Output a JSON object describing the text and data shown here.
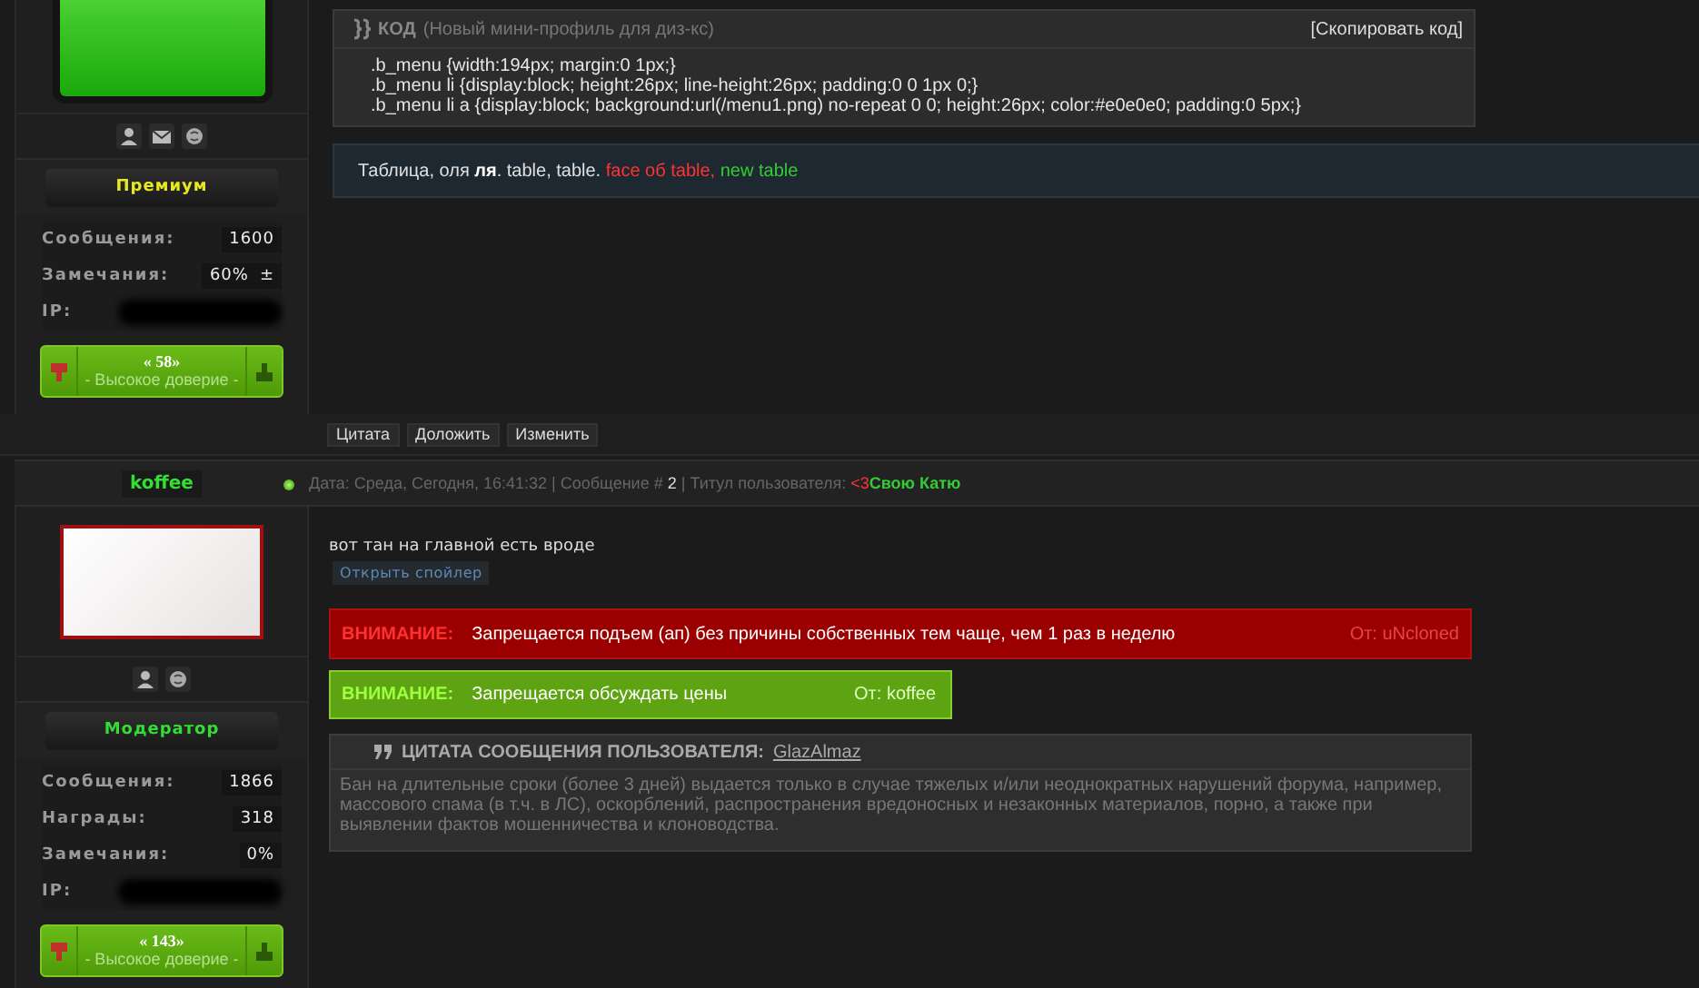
{
  "posts": [
    {
      "user": {
        "avatar": {
          "kind": "green-tile"
        },
        "contact_icons": [
          {
            "kind": "profile"
          },
          {
            "kind": "mail"
          },
          {
            "kind": "chat"
          }
        ],
        "rank": {
          "label": "Премиум",
          "color": "#e8e820"
        },
        "stats": [
          {
            "kind": "stat",
            "label": "Сообщения:",
            "value": "1600"
          },
          {
            "kind": "stat",
            "label": "Замечания:",
            "value": "60%",
            "extra": "±"
          },
          {
            "kind": "ip",
            "label": "IP:"
          }
        ],
        "reputation": {
          "score": "« 58»",
          "label": "- Высокое доверие -"
        }
      },
      "body": {
        "code": {
          "title": "КОД",
          "note": "(Новый мини-профиль для диз-кс)",
          "copy": "[Скопировать код]",
          "lines": [
            ".b_menu {width:194px; margin:0 1px;}",
            ".b_menu li {display:block; height:26px; line-height:26px; padding:0 0 1px 0;}",
            ".b_menu li a {display:block; background:url(/menu1.png) no-repeat 0 0; height:26px; color:#e0e0e0; padding:0 5px;}"
          ]
        },
        "table_text": [
          {
            "text": "Таблица, оля ",
            "kind": "plain"
          },
          {
            "text": "ля",
            "kind": "bold"
          },
          {
            "text": ". table, table. ",
            "kind": "plain"
          },
          {
            "text": "face об table,",
            "kind": "red"
          },
          {
            "text": " new table",
            "kind": "green"
          }
        ]
      },
      "buttons": [
        "Цитата",
        "Доложить",
        "Изменить"
      ]
    },
    {
      "header": {
        "username": "koffee",
        "online": true,
        "meta": [
          {
            "text": "Дата: Среда, Сегодня, 16:41:32 | Сообщение # ",
            "kind": "muted"
          },
          {
            "text": "2",
            "kind": "bright"
          },
          {
            "text": " | Титул пользователя: ",
            "kind": "muted"
          },
          {
            "text": "<3",
            "kind": "red"
          },
          {
            "text": "Свою Катю",
            "kind": "green"
          }
        ]
      },
      "user": {
        "avatar": {
          "kind": "banner"
        },
        "contact_icons": [
          {
            "kind": "profile"
          },
          {
            "kind": "chat"
          }
        ],
        "rank": {
          "label": "Модератор",
          "color": "#33dd33"
        },
        "stats": [
          {
            "kind": "stat",
            "label": "Сообщения:",
            "value": "1866"
          },
          {
            "kind": "stat",
            "label": "Награды:",
            "value": "318"
          },
          {
            "kind": "stat",
            "label": "Замечания:",
            "value": "0%"
          },
          {
            "kind": "ip",
            "label": "IP:"
          }
        ],
        "reputation": {
          "score": "« 143»",
          "label": "- Высокое доверие -"
        }
      },
      "body": {
        "text": "вот тан на главной есть вроде",
        "spoiler": "Открыть спойлер",
        "notices": [
          {
            "kind": "red",
            "label": "ВНИМАНИЕ:",
            "text": "Запрещается подъем (ап) без причины собственных тем чаще, чем 1 раз в неделю",
            "from": "От: uNcloned"
          },
          {
            "kind": "green",
            "label": "ВНИМАНИЕ:",
            "text": "Запрещается обсуждать цены",
            "from": "От: koffee"
          }
        ],
        "quote": {
          "title": "ЦИТАТА СООБЩЕНИЯ ПОЛЬЗОВАТЕЛЯ:",
          "author": "GlazAlmaz",
          "text": "Бан на длительные сроки (более 3 дней) выдается только в случае тяжелых и/или неоднократных нарушений форума, например, массового спама (в т.ч. в ЛС), оскорблений, распространения вредоносных и незаконных материалов, порно, а также при выявлении фактов мошенничества и клоноводства."
        }
      }
    }
  ]
}
